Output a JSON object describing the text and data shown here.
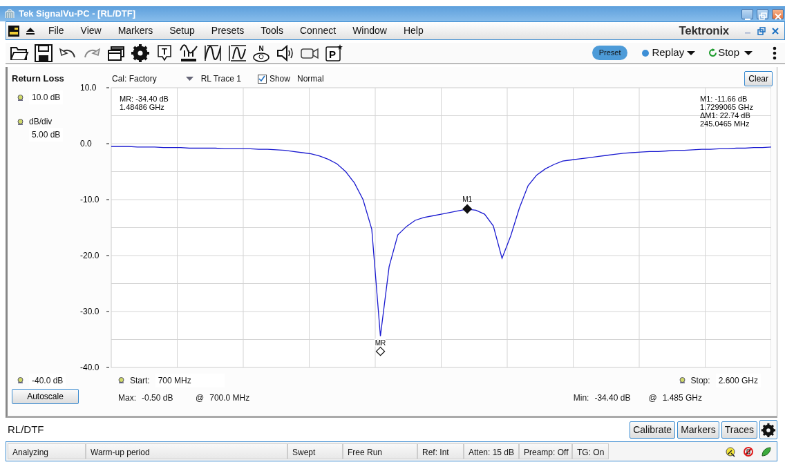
{
  "window": {
    "title": "Tek SignalVu-PC - [RL/DTF]"
  },
  "menu": [
    "File",
    "View",
    "Markers",
    "Setup",
    "Presets",
    "Tools",
    "Connect",
    "Window",
    "Help"
  ],
  "logo": "Tektronix",
  "toolbar": [
    {
      "kind": "folder"
    },
    {
      "kind": "floppy"
    },
    {
      "kind": "undo"
    },
    {
      "kind": "redo"
    },
    {
      "kind": "windows"
    },
    {
      "kind": "gear"
    },
    {
      "kind": "callout",
      "glyph": "T"
    },
    {
      "kind": "spectrum"
    },
    {
      "kind": "width"
    },
    {
      "kind": "height"
    },
    {
      "kind": "disc",
      "glyph": "N"
    },
    {
      "kind": "speaker"
    },
    {
      "kind": "camera"
    },
    {
      "kind": "pbox",
      "glyph": "P"
    }
  ],
  "preset": "Preset",
  "replay": "Replay",
  "stop": "Stop",
  "panel": {
    "title": "Return Loss",
    "cal": "Cal: Factory",
    "show": {
      "label": "Show",
      "checked": true
    },
    "mode": "Normal",
    "clear": "Clear",
    "ref_level": "10.0 dB",
    "scale_label": "dB/div",
    "scale": "5.00 dB",
    "bottom_level": "-40.0 dB",
    "autoscale": "Autoscale",
    "start_label": "Start:",
    "start": "700 MHz",
    "stop_label": "Stop:",
    "stop": "2.600 GHz",
    "max": {
      "label": "Max:",
      "value": "-0.50 dB",
      "at": "@",
      "freq": "700.0 MHz"
    },
    "min": {
      "label": "Min:",
      "value": "-34.40 dB",
      "at": "@",
      "freq": "1.485 GHz"
    },
    "readout_left": [
      "MR: -34.40 dB",
      "1.48486 GHz"
    ],
    "readout_right": [
      "M1: -11.66 dB",
      "1.7299065 GHz",
      "ΔM1: 22.74 dB",
      "245.0465 MHz"
    ],
    "markers": [
      {
        "kind": "reference"
      },
      {
        "kind": "marker"
      }
    ],
    "chart_data": {
      "type": "line",
      "ylim": [
        -40,
        10
      ],
      "yticks": [
        {
          "value": 10,
          "label": "10.0"
        },
        {
          "value": 0,
          "label": "0.0"
        },
        {
          "value": -10,
          "label": "-10.0"
        },
        {
          "value": -20,
          "label": "-20.0"
        },
        {
          "value": -30,
          "label": "-30.0"
        },
        {
          "value": -40,
          "label": "-40.0"
        }
      ],
      "categories": [
        null,
        null,
        null,
        null,
        null,
        null,
        null,
        null,
        null,
        null,
        null,
        null,
        null,
        null,
        null,
        null,
        null,
        null,
        null,
        null,
        null,
        null,
        null,
        null,
        null,
        null,
        null,
        null,
        null,
        null,
        null,
        null,
        null,
        null,
        null,
        null,
        null,
        null,
        null,
        null,
        null,
        null,
        null,
        null,
        null,
        null,
        null,
        null,
        null,
        null,
        null,
        null,
        null,
        null,
        null,
        null,
        null,
        null,
        null,
        null,
        null,
        null,
        null,
        null,
        null,
        null,
        null,
        null,
        null,
        null,
        null,
        null,
        null,
        null,
        null,
        null,
        null
      ],
      "series": [
        {
          "name": "RL Trace 1",
          "color": "#1a1ad0",
          "values": [
            -0.5,
            -0.5,
            -0.5,
            -0.6,
            -0.6,
            -0.6,
            -0.7,
            -0.7,
            -0.7,
            -0.8,
            -0.8,
            -0.8,
            -0.8,
            -0.9,
            -0.9,
            -0.9,
            -0.9,
            -1.0,
            -1.0,
            -1.1,
            -1.2,
            -1.4,
            -1.6,
            -1.8,
            -2.2,
            -2.8,
            -3.6,
            -5.0,
            -7.0,
            -10.0,
            -15.3,
            -34.4,
            -22.0,
            -16.3,
            -14.8,
            -13.7,
            -13.2,
            -12.9,
            -12.6,
            -12.3,
            -12.0,
            -11.7,
            -11.9,
            -12.6,
            -14.7,
            -20.5,
            -16.5,
            -11.5,
            -7.5,
            -5.6,
            -4.5,
            -3.7,
            -3.1,
            -2.9,
            -2.7,
            -2.5,
            -2.3,
            -2.1,
            -1.9,
            -1.7,
            -1.6,
            -1.5,
            -1.4,
            -1.4,
            -1.3,
            -1.2,
            -1.2,
            -1.1,
            -1.0,
            -1.0,
            -0.9,
            -0.9,
            -0.8,
            -0.8,
            -0.7,
            -0.7,
            -0.6
          ]
        }
      ],
      "grid": true,
      "annotations": [
        {
          "text": "MR",
          "y": -34.4
        },
        {
          "text": "M1",
          "y": -11.66
        }
      ]
    }
  },
  "footer": {
    "title": "RL/DTF",
    "buttons": [
      "Calibrate",
      "Markers",
      "Traces"
    ]
  },
  "status_bar": [
    "Analyzing",
    "Warm-up period",
    "Swept",
    "Free Run",
    "Ref: Int",
    "Atten: 15 dB",
    "Preamp: Off",
    "TG: On"
  ]
}
